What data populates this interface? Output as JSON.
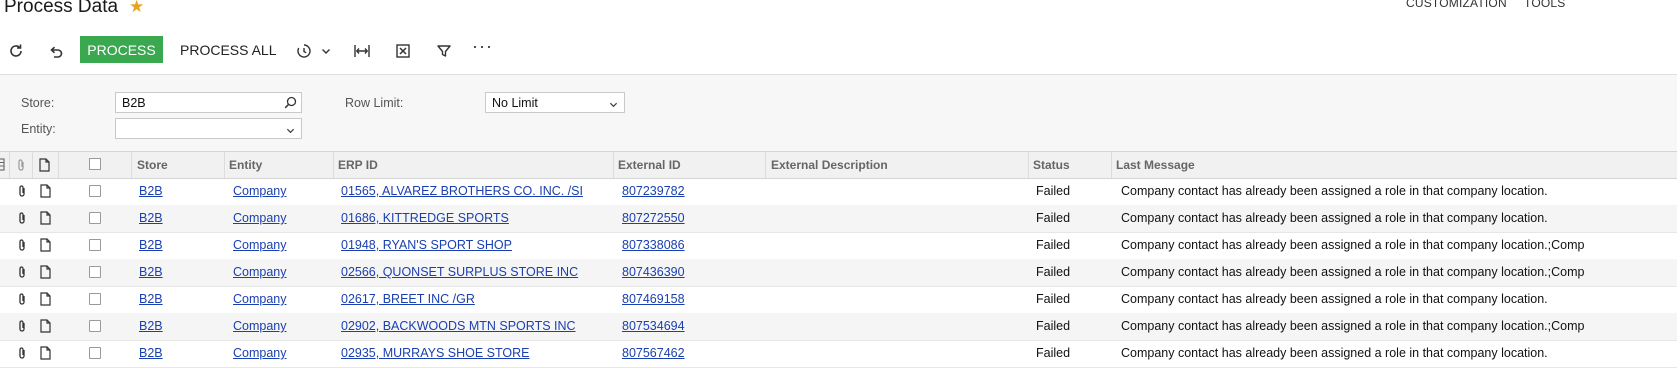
{
  "header": {
    "title": "Process Data",
    "star_icon": "star-icon",
    "customization_label": "CUSTOMIZATION",
    "tools_label": "TOOLS"
  },
  "toolbar": {
    "refresh_icon": "refresh-icon",
    "undo_icon": "undo-icon",
    "process_label": "PROCESS",
    "process_all_label": "PROCESS ALL",
    "schedule_icon": "schedule-icon",
    "fit_columns_icon": "fit-columns-icon",
    "excel_icon": "export-excel-icon",
    "filter_icon": "filter-icon",
    "more_label": "···",
    "accent_color": "#3aa84f"
  },
  "filters": {
    "store_label": "Store:",
    "store_value": "B2B",
    "row_limit_label": "Row Limit:",
    "row_limit_value": "No Limit",
    "entity_label": "Entity:",
    "entity_value": ""
  },
  "grid": {
    "columns": [
      "Store",
      "Entity",
      "ERP ID",
      "External ID",
      "External Description",
      "Status",
      "Last Message"
    ],
    "link_color": "#1a3fb0",
    "rows": [
      {
        "store": "B2B",
        "entity": "Company",
        "erp_id": "01565, ALVAREZ BROTHERS CO. INC. /SI",
        "external_id": "807239782",
        "external_description": "",
        "status": "Failed",
        "last_message": "Company contact has already been assigned a role in that company location."
      },
      {
        "store": "B2B",
        "entity": "Company",
        "erp_id": "01686, KITTREDGE SPORTS",
        "external_id": "807272550",
        "external_description": "",
        "status": "Failed",
        "last_message": "Company contact has already been assigned a role in that company location."
      },
      {
        "store": "B2B",
        "entity": "Company",
        "erp_id": "01948, RYAN'S SPORT SHOP",
        "external_id": "807338086",
        "external_description": "",
        "status": "Failed",
        "last_message": "Company contact has already been assigned a role in that company location.;Comp"
      },
      {
        "store": "B2B",
        "entity": "Company",
        "erp_id": "02566, QUONSET SURPLUS STORE INC",
        "external_id": "807436390",
        "external_description": "",
        "status": "Failed",
        "last_message": "Company contact has already been assigned a role in that company location.;Comp"
      },
      {
        "store": "B2B",
        "entity": "Company",
        "erp_id": "02617, BREET INC /GR",
        "external_id": "807469158",
        "external_description": "",
        "status": "Failed",
        "last_message": "Company contact has already been assigned a role in that company location."
      },
      {
        "store": "B2B",
        "entity": "Company",
        "erp_id": "02902, BACKWOODS MTN SPORTS INC",
        "external_id": "807534694",
        "external_description": "",
        "status": "Failed",
        "last_message": "Company contact has already been assigned a role in that company location.;Comp"
      },
      {
        "store": "B2B",
        "entity": "Company",
        "erp_id": "02935, MURRAYS SHOE STORE",
        "external_id": "807567462",
        "external_description": "",
        "status": "Failed",
        "last_message": "Company contact has already been assigned a role in that company location."
      }
    ]
  }
}
